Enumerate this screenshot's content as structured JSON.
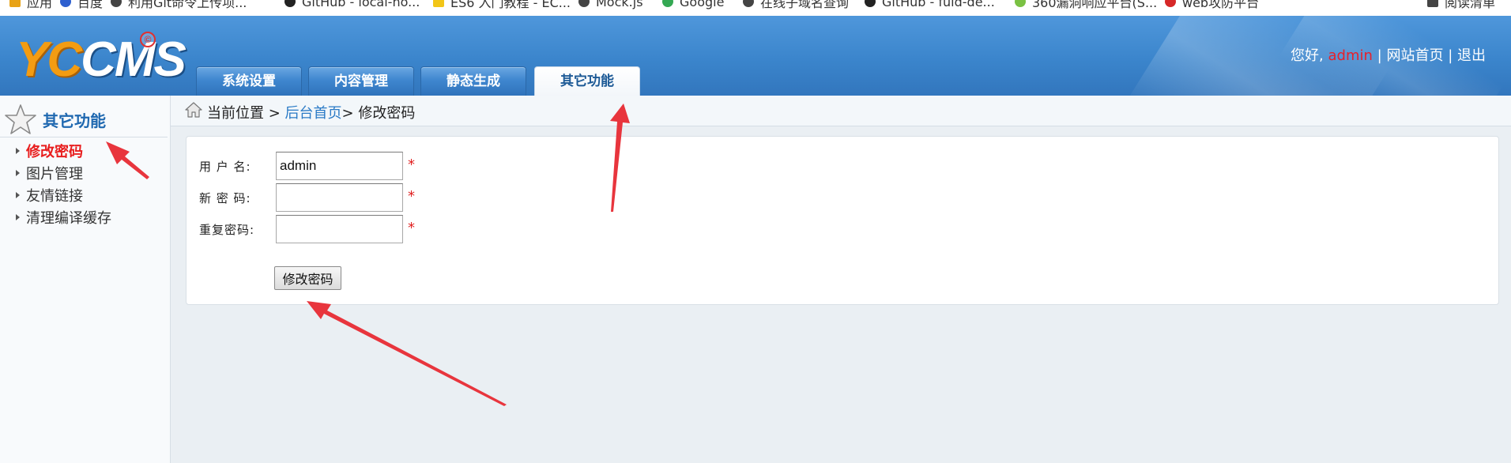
{
  "bookmarks": [
    {
      "label": "应用",
      "icon": "apps-grid-icon",
      "color": "#e8a317"
    },
    {
      "label": "百度",
      "icon": "baidu-paw-icon",
      "color": "#2d5fcf"
    },
    {
      "label": "利用Git命令上传项...",
      "icon": "search-icon",
      "color": "#444444"
    },
    {
      "label": "GitHub - local-no...",
      "icon": "github-icon",
      "color": "#222222"
    },
    {
      "label": "ES6 入门教程 - EC...",
      "icon": "es6-icon",
      "color": "#f2c618"
    },
    {
      "label": "Mock.js",
      "icon": "mockjs-icon",
      "color": "#444444"
    },
    {
      "label": "Google",
      "icon": "google-icon",
      "color": "#34a853"
    },
    {
      "label": "在线子域名查询",
      "icon": "globe-icon",
      "color": "#444444"
    },
    {
      "label": "GitHub - fuld-de...",
      "icon": "github-icon",
      "color": "#222222"
    },
    {
      "label": "360漏洞响应平台(S...",
      "icon": "360-icon",
      "color": "#7ac143"
    },
    {
      "label": "web攻防平台",
      "icon": "web-attack-icon",
      "color": "#d62828"
    },
    {
      "label": "阅读清单",
      "icon": "reading-list-icon",
      "color": "#444444"
    }
  ],
  "header": {
    "logo_part1": "YC",
    "logo_part2": "CMS",
    "logo_reg": "©",
    "greeting": "您好,",
    "username": "admin",
    "separator1": "|",
    "site_home": "网站首页",
    "separator2": "|",
    "logout": "退出"
  },
  "tabs": [
    {
      "label": "系统设置",
      "active": false
    },
    {
      "label": "内容管理",
      "active": false
    },
    {
      "label": "静态生成",
      "active": false
    },
    {
      "label": "其它功能",
      "active": true
    }
  ],
  "sidebar": {
    "title": "其它功能",
    "items": [
      {
        "label": "修改密码",
        "active": true
      },
      {
        "label": "图片管理",
        "active": false
      },
      {
        "label": "友情链接",
        "active": false
      },
      {
        "label": "清理编译缓存",
        "active": false
      }
    ]
  },
  "breadcrumb": {
    "prefix": "当前位置 >",
    "home": "后台首页",
    "sep": ">",
    "current": "修改密码"
  },
  "form": {
    "username_label": "用 户 名:",
    "username_value": "admin",
    "new_password_label": "新 密 码:",
    "new_password_value": "",
    "repeat_password_label": "重复密码:",
    "repeat_password_value": "",
    "required_mark": "*",
    "submit_label": "修改密码"
  },
  "colors": {
    "header_blue": "#3b85cc",
    "active_red": "#e81e1e",
    "link_blue": "#2a7ac6",
    "annotation_arrow": "#e8353d"
  }
}
